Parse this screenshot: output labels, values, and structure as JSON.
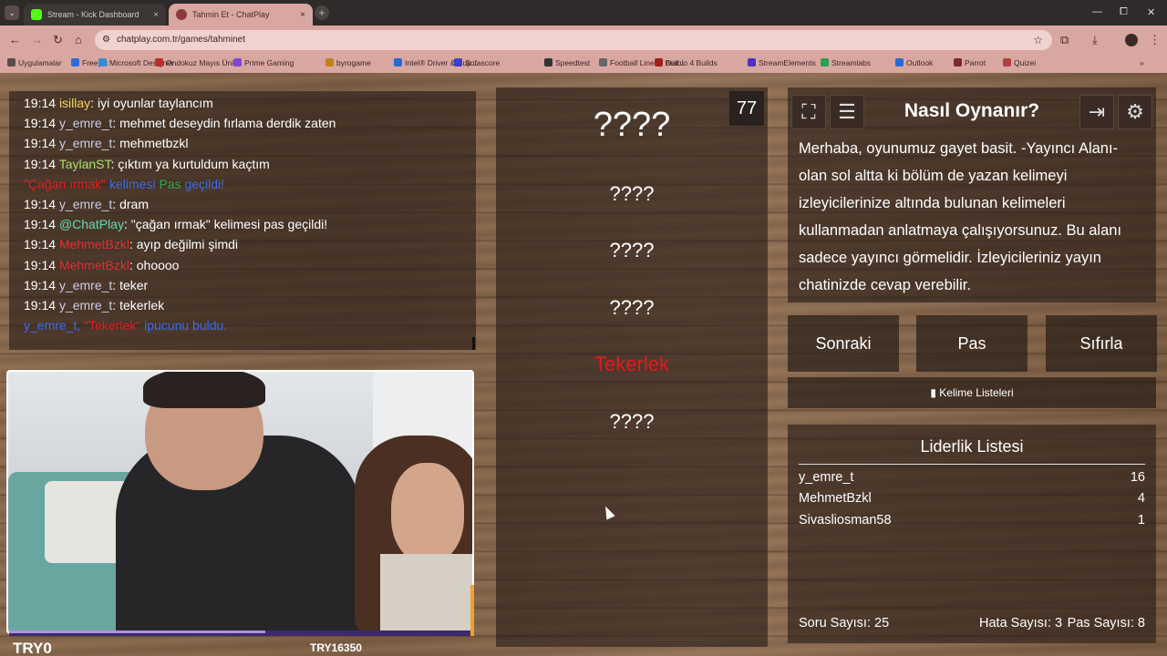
{
  "browser": {
    "tabs": [
      {
        "label": "Stream - Kick Dashboard",
        "close": "×"
      },
      {
        "label": "Tahmin Et - ChatPlay",
        "close": "×"
      }
    ],
    "new_tab": "+",
    "menu": "⌄",
    "window_controls": {
      "minimize": "—",
      "maximize": "⧠",
      "close": "✕"
    },
    "url": "chatplay.com.tr/games/tahminet",
    "bookmarks": [
      "Uygulamalar",
      "Freepik",
      "Microsoft Designer",
      "Ondokuz Mayıs Üni...",
      "Prime Gaming",
      "byrogame",
      "Intel® Driver & Sup...",
      "Sofascore",
      "Speedtest",
      "Football Lineup Buil...",
      "Diablo 4 Builds",
      "StreamElements",
      "Streamlabs",
      "Outlook",
      "Parrot",
      "Quizei"
    ],
    "bookmark_colors": [
      "#5a4c4a",
      "#2f6bd8",
      "#3a8ad8",
      "#b8302c",
      "#7a4ad0",
      "#c08020",
      "#2a6ad0",
      "#3a40c8",
      "#333333",
      "#666666",
      "#a02020",
      "#5030c0",
      "#2aa050",
      "#2a6ad0",
      "#7a2a2a",
      "#b04040"
    ]
  },
  "chat": [
    {
      "time": "19:14",
      "user": "isillay",
      "user_class": "u-isi",
      "text": "iyi oyunlar taylancım"
    },
    {
      "time": "19:14",
      "user": "y_emre_t",
      "user_class": "u-y",
      "text": "mehmet deseydin fırlama derdik zaten"
    },
    {
      "time": "19:14",
      "user": "y_emre_t",
      "user_class": "u-y",
      "text": "mehmetbzkl"
    },
    {
      "time": "19:14",
      "user": "TaylanST",
      "user_class": "u-tay",
      "text": "çıktım ya kurtuldum kaçtım"
    },
    {
      "system": true,
      "parts": [
        {
          "t": "\"Çağan ırmak\"",
          "c": "sys-red"
        },
        {
          "t": " kelimesi ",
          "c": "sys-blue"
        },
        {
          "t": "Pas",
          "c": "sys-green"
        },
        {
          "t": " geçildi!",
          "c": "sys-blue"
        }
      ]
    },
    {
      "time": "19:14",
      "user": "y_emre_t",
      "user_class": "u-y",
      "text": "dram"
    },
    {
      "time": "19:14",
      "user": "@ChatPlay",
      "user_class": "u-cp",
      "text": "\"çağan ırmak\" kelimesi pas geçildi!"
    },
    {
      "time": "19:14",
      "user": "MehmetBzkl",
      "user_class": "u-mb",
      "text": "ayıp değilmi şimdi"
    },
    {
      "time": "19:14",
      "user": "MehmetBzkl",
      "user_class": "u-mb",
      "text": "ohoooo"
    },
    {
      "time": "19:14",
      "user": "y_emre_t",
      "user_class": "u-y",
      "text": "teker"
    },
    {
      "time": "19:14",
      "user": "y_emre_t",
      "user_class": "u-y",
      "text": "tekerlek"
    },
    {
      "system": true,
      "parts": [
        {
          "t": "y_emre_t, ",
          "c": "sys-blue"
        },
        {
          "t": "\"Tekerlek\"",
          "c": "sys-red"
        },
        {
          "t": " ipucunu buldu.",
          "c": "sys-blue"
        }
      ]
    }
  ],
  "camera": {
    "left_label": "TRY0",
    "right_label": "TRY16350"
  },
  "game": {
    "timer": "77",
    "words": [
      "????",
      "????",
      "????",
      "????",
      "Tekerlek",
      "????"
    ]
  },
  "howto": {
    "title": "Nasıl Oynanır?",
    "text": "Merhaba, oyunumuz gayet basit. -Yayıncı Alanı- olan sol altta ki bölüm de yazan kelimeyi izleyicilerinize altında bulunan kelimeleri kullanmadan anlatmaya çalışıyorsunuz. Bu alanı sadece yayıncı görmelidir. İzleyicileriniz yayın chatinizde cevap verebilir.",
    "icons": {
      "fullscreen": "⛶",
      "list": "☰",
      "exit": "⇥",
      "settings": "⚙"
    }
  },
  "actions": {
    "next": "Sonraki",
    "pass": "Pas",
    "reset": "Sıfırla",
    "word_lists_icon": "▮",
    "word_lists": "Kelime Listeleri"
  },
  "leaderboard": {
    "title": "Liderlik Listesi",
    "rows": [
      {
        "name": "y_emre_t",
        "score": "16"
      },
      {
        "name": "MehmetBzkl",
        "score": "4"
      },
      {
        "name": "Sivasliosman58",
        "score": "1"
      }
    ]
  },
  "stats": {
    "questions": "Soru Sayısı: 25",
    "errors": "Hata Sayısı: 3",
    "passes": "Pas Sayısı: 8"
  }
}
